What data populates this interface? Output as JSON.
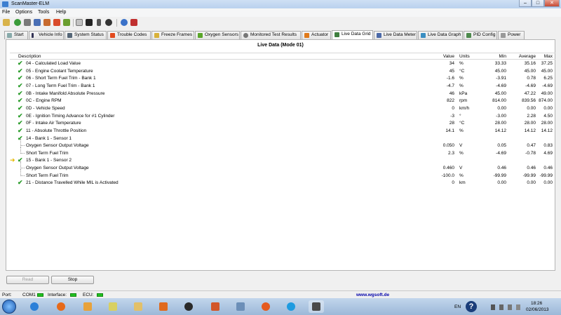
{
  "window": {
    "title": "ScanMaster-ELM",
    "min": "–",
    "max": "□",
    "close": "✕"
  },
  "menu": [
    "File",
    "Options",
    "Tools",
    "Help"
  ],
  "toolbar": {
    "icons": [
      "open-icon",
      "connect-icon",
      "disconnect-icon",
      "save-icon",
      "print-icon",
      "gauge-icon",
      "settings-icon",
      "monitor-icon",
      "battery-icon",
      "record-icon",
      "info-icon",
      "pdf-icon"
    ]
  },
  "tabs": [
    {
      "label": "Start",
      "icon": "start-icon"
    },
    {
      "label": "Vehicle Info",
      "icon": "info-icon"
    },
    {
      "label": "System Status",
      "icon": "status-icon"
    },
    {
      "label": "Trouble Codes",
      "icon": "warning-icon"
    },
    {
      "label": "Freeze Frames",
      "icon": "freeze-icon"
    },
    {
      "label": "Oxygen Sensors",
      "icon": "sensor-icon"
    },
    {
      "label": "Monitored Test Results",
      "icon": "gear-icon"
    },
    {
      "label": "Actuator",
      "icon": "actuator-icon"
    },
    {
      "label": "Live Data Grid",
      "icon": "grid-icon"
    },
    {
      "label": "Live Data Meter",
      "icon": "meter-icon"
    },
    {
      "label": "Live Data Graph",
      "icon": "graph-icon"
    },
    {
      "label": "PID Config",
      "icon": "config-icon"
    },
    {
      "label": "Power",
      "icon": "power-icon"
    }
  ],
  "active_tab": "Live Data Grid",
  "grid": {
    "title": "Live Data (Mode 01)",
    "headers": {
      "description": "Description",
      "value": "Value",
      "units": "Units",
      "min": "Min",
      "average": "Average",
      "max": "Max"
    },
    "rows": [
      {
        "desc": "04 - Calculated Load Value",
        "value": "34",
        "unit": "%",
        "min": "33.33",
        "avg": "35.16",
        "max": "37.25",
        "check": true
      },
      {
        "desc": "05 - Engine Coolant Temperature",
        "value": "45",
        "unit": "°C",
        "min": "45.00",
        "avg": "45.00",
        "max": "45.00",
        "check": true
      },
      {
        "desc": "06 - Short Term Fuel Trim - Bank 1",
        "value": "-1.6",
        "unit": "%",
        "min": "-3.91",
        "avg": "0.78",
        "max": "6.25",
        "check": true
      },
      {
        "desc": "07 - Long Term Fuel Trim - Bank 1",
        "value": "-4.7",
        "unit": "%",
        "min": "-4.69",
        "avg": "-4.69",
        "max": "-4.69",
        "check": true
      },
      {
        "desc": "0B - Intake Manifold Absolute Pressure",
        "value": "46",
        "unit": "kPa",
        "min": "45.00",
        "avg": "47.22",
        "max": "49.00",
        "check": true
      },
      {
        "desc": "0C - Engine RPM",
        "value": "822",
        "unit": "rpm",
        "min": "814.00",
        "avg": "839.56",
        "max": "874.00",
        "check": true
      },
      {
        "desc": "0D - Vehicle Speed",
        "value": "0",
        "unit": "km/h",
        "min": "0.00",
        "avg": "0.00",
        "max": "0.00",
        "check": true
      },
      {
        "desc": "0E - Ignition Timing Advance for #1 Cylinder",
        "value": "-3",
        "unit": "°",
        "min": "-3.00",
        "avg": "2.28",
        "max": "4.50",
        "check": true
      },
      {
        "desc": "0F - Intake Air Temperature",
        "value": "28",
        "unit": "°C",
        "min": "28.00",
        "avg": "28.00",
        "max": "28.00",
        "check": true
      },
      {
        "desc": "11 - Absolute Throttle Position",
        "value": "14.1",
        "unit": "%",
        "min": "14.12",
        "avg": "14.12",
        "max": "14.12",
        "check": true
      },
      {
        "desc": "14 - Bank 1 - Sensor 1",
        "value": "",
        "unit": "",
        "min": "",
        "avg": "",
        "max": "",
        "check": true
      },
      {
        "desc": "Oxygen Sensor Output Voltage",
        "value": "0.050",
        "unit": "V",
        "min": "0.05",
        "avg": "0.47",
        "max": "0.83",
        "child": true
      },
      {
        "desc": "Short Term Fuel Trim",
        "value": "2.3",
        "unit": "%",
        "min": "-4.69",
        "avg": "-0.78",
        "max": "4.69",
        "child": true
      },
      {
        "desc": "15 - Bank 1 - Sensor 2",
        "value": "",
        "unit": "",
        "min": "",
        "avg": "",
        "max": "",
        "check": true,
        "selected": true
      },
      {
        "desc": "Oxygen Sensor Output Voltage",
        "value": "0.460",
        "unit": "V",
        "min": "0.46",
        "avg": "0.46",
        "max": "0.46",
        "child": true
      },
      {
        "desc": "Short Term Fuel Trim",
        "value": "-100.0",
        "unit": "%",
        "min": "-99.99",
        "avg": "-99.99",
        "max": "-99.99",
        "child": true
      },
      {
        "desc": "21 - Distance Travelled While MIL is Activated",
        "value": "0",
        "unit": "km",
        "min": "0.00",
        "avg": "0.00",
        "max": "0.00",
        "check": true
      }
    ]
  },
  "buttons": {
    "read": "Read",
    "stop": "Stop"
  },
  "status": {
    "port_label": "Port:",
    "port_value": "COM1",
    "interface_label": "Interface:",
    "ecu_label": "ECU:",
    "url": "www.wgsoft.de"
  },
  "taskbar": {
    "apps": [
      "ie-icon",
      "firefox-icon",
      "outlook-icon",
      "explorer-icon",
      "folder-icon",
      "media-icon",
      "hp-icon",
      "office-icon",
      "calculator-icon",
      "app-icon",
      "skype-icon",
      "chip-icon"
    ],
    "lang": "EN",
    "time": "18:26",
    "date": "02/06/2013"
  },
  "colors": {
    "check": "#2a9c2a",
    "selected_arrow": "#e6b800",
    "led": "#22c022",
    "url": "#0000aa"
  }
}
